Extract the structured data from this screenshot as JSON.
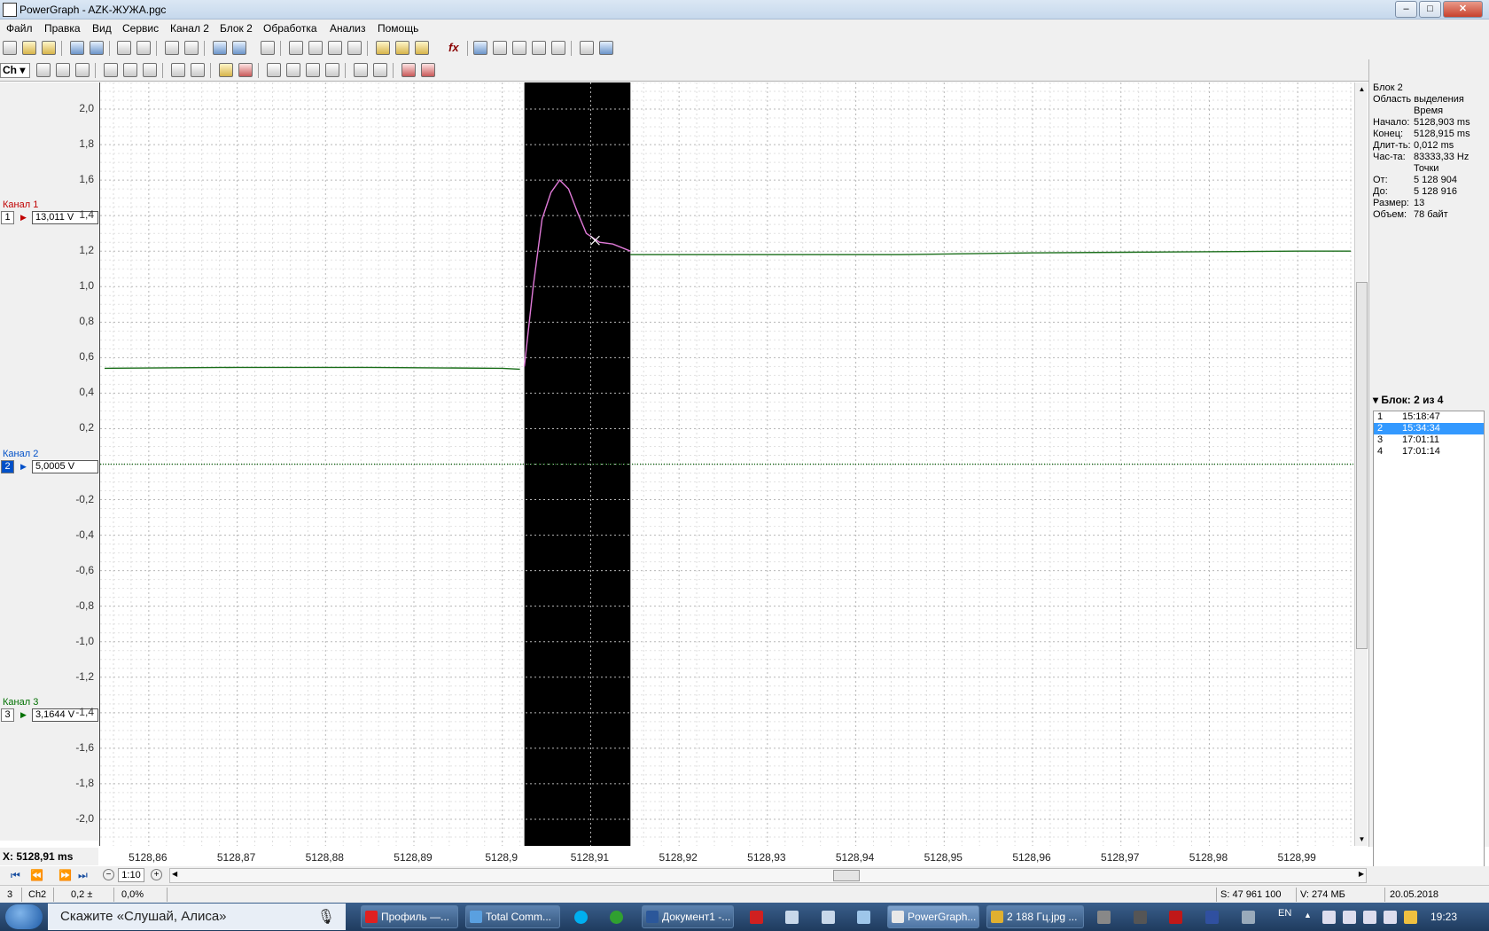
{
  "window": {
    "title": "PowerGraph - AZK-ЖУЖА.pgc",
    "controls": {
      "minimize": "–",
      "maximize": "□",
      "close": "✕"
    }
  },
  "menu": [
    "Файл",
    "Правка",
    "Вид",
    "Сервис",
    "Канал 2",
    "Блок 2",
    "Обработка",
    "Анализ",
    "Помощь"
  ],
  "toolbar": {
    "ch_combo": "Ch",
    "fx_label": "fx"
  },
  "channels": [
    {
      "label": "Канал 1",
      "num": "1",
      "value": "13,011 V",
      "color": "#c00000"
    },
    {
      "label": "Канал 2",
      "num": "2",
      "value": "5,0005 V",
      "color": "#0050c8"
    },
    {
      "label": "Канал 3",
      "num": "3",
      "value": "3,1644 V",
      "color": "#007000"
    }
  ],
  "y_ticks": [
    "2,0",
    "1,8",
    "1,6",
    "1,4",
    "1,2",
    "1,0",
    "0,8",
    "0,6",
    "0,4",
    "0,2",
    "-0,2",
    "-0,4",
    "-0,6",
    "-0,8",
    "-1,0",
    "-1,2",
    "-1,4",
    "-1,6",
    "-1,8",
    "-2,0"
  ],
  "chart_data": {
    "type": "line",
    "x_unit": "ms",
    "x_tick_labels": [
      "5128,86",
      "5128,87",
      "5128,88",
      "5128,89",
      "5128,9",
      "5128,91",
      "5128,92",
      "5128,93",
      "5128,94",
      "5128,95",
      "5128,96",
      "5128,97",
      "5128,98",
      "5128,99"
    ],
    "x_range": [
      5128.8545,
      5128.9965
    ],
    "y_range": [
      -2.15,
      2.15
    ],
    "grid": true,
    "selection": {
      "start": 5128.9025,
      "end": 5128.9145,
      "background": "#000000"
    },
    "series": [
      {
        "color": "#1a6e1a",
        "segments": [
          {
            "x": [
              5128.855,
              5128.87,
              5128.885,
              5128.9,
              5128.902
            ],
            "y": [
              0.54,
              0.545,
              0.545,
              0.54,
              0.535
            ]
          },
          {
            "x": [
              5128.9145,
              5128.93,
              5128.945,
              5128.96,
              5128.975,
              5128.99,
              5128.996
            ],
            "y": [
              1.18,
              1.18,
              1.18,
              1.19,
              1.195,
              1.2,
              1.2
            ]
          }
        ]
      },
      {
        "color": "#e07ad8",
        "segments": [
          {
            "x": [
              5128.9025,
              5128.9035,
              5128.9045,
              5128.9055,
              5128.9065,
              5128.9075,
              5128.9085,
              5128.9095,
              5128.911,
              5128.9125,
              5128.9145
            ],
            "y": [
              0.55,
              1.0,
              1.38,
              1.53,
              1.6,
              1.55,
              1.42,
              1.3,
              1.25,
              1.24,
              1.2
            ]
          }
        ]
      },
      {
        "color": "#1a6e1a",
        "dashed": true,
        "segments": [
          {
            "x": [
              5128.8545,
              5128.9965
            ],
            "y": [
              0.0,
              0.0
            ]
          }
        ]
      }
    ],
    "cursor": {
      "x": 5128.9105,
      "y": 1.26
    }
  },
  "right_panel": {
    "block_title": "Блок 2",
    "selection_area": "Область выделения",
    "time_header": "Время",
    "rows_time": [
      {
        "k": "Начало:",
        "v": "5128,903 ms"
      },
      {
        "k": "Конец:",
        "v": "5128,915 ms"
      },
      {
        "k": "Длит-ть:",
        "v": "0,012 ms"
      },
      {
        "k": "Час-та:",
        "v": "83333,33 Hz"
      }
    ],
    "points_header": "Точки",
    "rows_points": [
      {
        "k": "От:",
        "v": "5 128 904"
      },
      {
        "k": "До:",
        "v": "5 128 916"
      },
      {
        "k": "Размер:",
        "v": "13"
      },
      {
        "k": "Объем:",
        "v": "78 байт"
      }
    ],
    "block_header": "Блок: 2 из 4",
    "blocks": [
      {
        "n": "1",
        "t": "15:18:47"
      },
      {
        "n": "2",
        "t": "15:34:34"
      },
      {
        "n": "3",
        "t": "17:01:11"
      },
      {
        "n": "4",
        "t": "17:01:14"
      }
    ],
    "selected_block": 1
  },
  "bottom": {
    "x_coord": "X: 5128,91 ms",
    "zoom": "1:10"
  },
  "status": {
    "ch_num": "3",
    "ch_name": "Ch2",
    "val1": "0,2 ±",
    "val2": "0,0%",
    "samples": "S: 47 961 100",
    "memory": "V: 274 МБ",
    "date": "20.05.2018"
  },
  "taskbar": {
    "search_text": "Скажите «Слушай, Алиса»",
    "tasks": [
      "Профиль —...",
      "Total Comm...",
      "Документ1 -...",
      "PowerGraph...",
      "2 188 Гц.jpg ..."
    ],
    "lang": "EN",
    "clock": "19:23"
  }
}
